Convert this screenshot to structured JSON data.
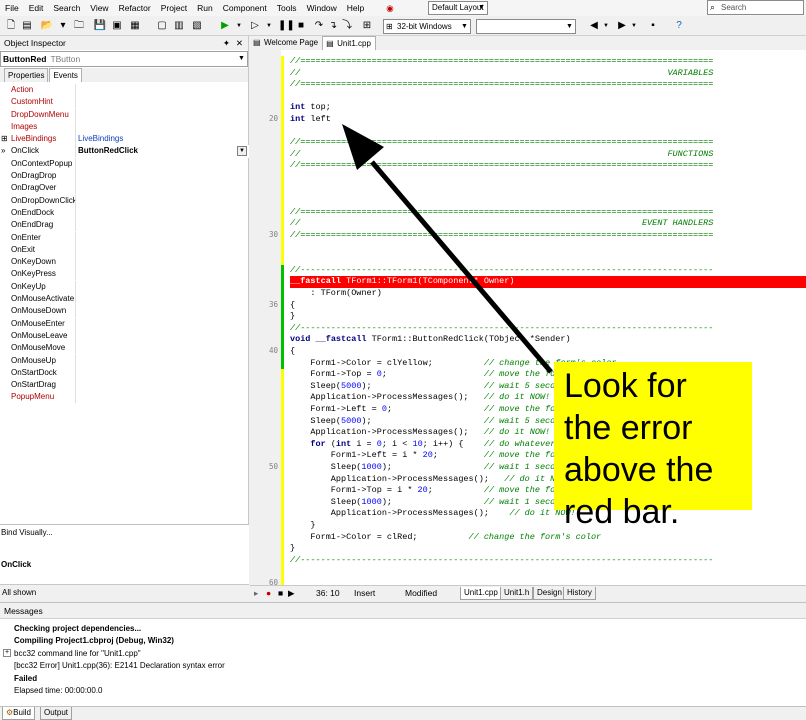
{
  "menu": [
    "File",
    "Edit",
    "Search",
    "View",
    "Refactor",
    "Project",
    "Run",
    "Component",
    "Tools",
    "Window",
    "Help"
  ],
  "layout_combo": "Default Layout",
  "search_placeholder": "Search",
  "platform_combo": "32-bit Windows",
  "inspector": {
    "title": "Object Inspector",
    "component_name": "ButtonRed",
    "component_class": "TButton",
    "tabs": [
      "Properties",
      "Events"
    ],
    "events": [
      {
        "name": "Action",
        "value": "",
        "red": true
      },
      {
        "name": "CustomHint",
        "value": "",
        "red": true
      },
      {
        "name": "DropDownMenu",
        "value": "",
        "red": true
      },
      {
        "name": "Images",
        "value": "",
        "red": true
      },
      {
        "name": "LiveBindings",
        "value": "LiveBindings",
        "red": true,
        "mark": "+"
      },
      {
        "name": "OnClick",
        "value": "ButtonRedClick",
        "selected": true,
        "mark": "»"
      },
      {
        "name": "OnContextPopup",
        "value": ""
      },
      {
        "name": "OnDragDrop",
        "value": ""
      },
      {
        "name": "OnDragOver",
        "value": ""
      },
      {
        "name": "OnDropDownClick",
        "value": ""
      },
      {
        "name": "OnEndDock",
        "value": ""
      },
      {
        "name": "OnEndDrag",
        "value": ""
      },
      {
        "name": "OnEnter",
        "value": ""
      },
      {
        "name": "OnExit",
        "value": ""
      },
      {
        "name": "OnKeyDown",
        "value": ""
      },
      {
        "name": "OnKeyPress",
        "value": ""
      },
      {
        "name": "OnKeyUp",
        "value": ""
      },
      {
        "name": "OnMouseActivate",
        "value": ""
      },
      {
        "name": "OnMouseDown",
        "value": ""
      },
      {
        "name": "OnMouseEnter",
        "value": ""
      },
      {
        "name": "OnMouseLeave",
        "value": ""
      },
      {
        "name": "OnMouseMove",
        "value": ""
      },
      {
        "name": "OnMouseUp",
        "value": ""
      },
      {
        "name": "OnStartDock",
        "value": ""
      },
      {
        "name": "OnStartDrag",
        "value": ""
      },
      {
        "name": "PopupMenu",
        "value": "",
        "red": true
      }
    ],
    "bind_visually": "Bind Visually...",
    "selected_event": "OnClick",
    "status": "All shown"
  },
  "editor_tabs": [
    {
      "label": "Welcome Page",
      "active": false
    },
    {
      "label": "Unit1.cpp",
      "active": true
    }
  ],
  "line_numbers": [
    "20",
    "30",
    "36",
    "40",
    "50",
    "60"
  ],
  "code_lines": [
    "//=================================================================================",
    "//                                                                        VARIABLES",
    "//=================================================================================",
    "",
    "int top;",
    "int left",
    "",
    "//=================================================================================",
    "//                                                                        FUNCTIONS",
    "//=================================================================================",
    "",
    "",
    "",
    "//=================================================================================",
    "//                                                                   EVENT HANDLERS",
    "//=================================================================================",
    "",
    "",
    "//---------------------------------------------------------------------------------",
    "__fastcall TForm1::TForm1(TComponent* Owner)",
    "    : TForm(Owner)",
    "{",
    "}",
    "//---------------------------------------------------------------------------------",
    "void __fastcall TForm1::ButtonRedClick(TObject *Sender)",
    "{",
    "    Form1->Color = clYellow;          // change the form's color",
    "    Form1->Top = 0;                   // move the form to the top",
    "    Sleep(5000);                      // wait 5 seconds",
    "    Application->ProcessMessages();   // do it NOW!",
    "    Form1->Left = 0;                  // move the form to the left",
    "    Sleep(5000);                      // wait 5 seconds",
    "    Application->ProcessMessages();   // do it NOW!",
    "    for (int i = 0; i < 10; i++) {    // do whatever",
    "        Form1->Left = i * 20;         // move the form right",
    "        Sleep(1000);                  // wait 1 second",
    "        Application->ProcessMessages();   // do it NOW!",
    "        Form1->Top = i * 20;          // move the form down",
    "        Sleep(1000);                  // wait 1 second",
    "        Application->ProcessMessages();    // do it NOW!",
    "    }",
    "    Form1->Color = clRed;          // change the form's color",
    "}",
    "//---------------------------------------------------------------------------------"
  ],
  "callout": "Look for the error above the red bar.",
  "status_bar": {
    "position": "36: 10",
    "mode": "Insert",
    "state": "Modified",
    "tabs": [
      "Unit1.cpp",
      "Unit1.h",
      "Design",
      "History"
    ]
  },
  "messages": {
    "title": "Messages",
    "lines": [
      {
        "text": "Checking project dependencies...",
        "bold": true
      },
      {
        "text": "Compiling Project1.cbproj (Debug, Win32)",
        "bold": true
      },
      {
        "text": "bcc32 command line for \"Unit1.cpp\"",
        "bold": false,
        "expand": true
      },
      {
        "text": "[bcc32 Error] Unit1.cpp(36): E2141 Declaration syntax error",
        "bold": false
      },
      {
        "text": "Failed",
        "bold": true
      },
      {
        "text": "Elapsed time: 00:00:00.0",
        "bold": false
      }
    ],
    "tabs": [
      "Build",
      "Output"
    ]
  },
  "colors": {
    "error_bar": "#ff0000",
    "callout_bg": "#ffff00",
    "comment": "#008000",
    "keyword": "#000080",
    "modified_line": "#ffff00",
    "saved_line": "#00c000"
  },
  "icons": [
    "new-file-icon",
    "open-folder-icon",
    "save-icon",
    "save-all-icon",
    "run-icon",
    "pause-icon",
    "stop-icon",
    "back-icon",
    "forward-icon",
    "help-icon",
    "search-icon"
  ]
}
